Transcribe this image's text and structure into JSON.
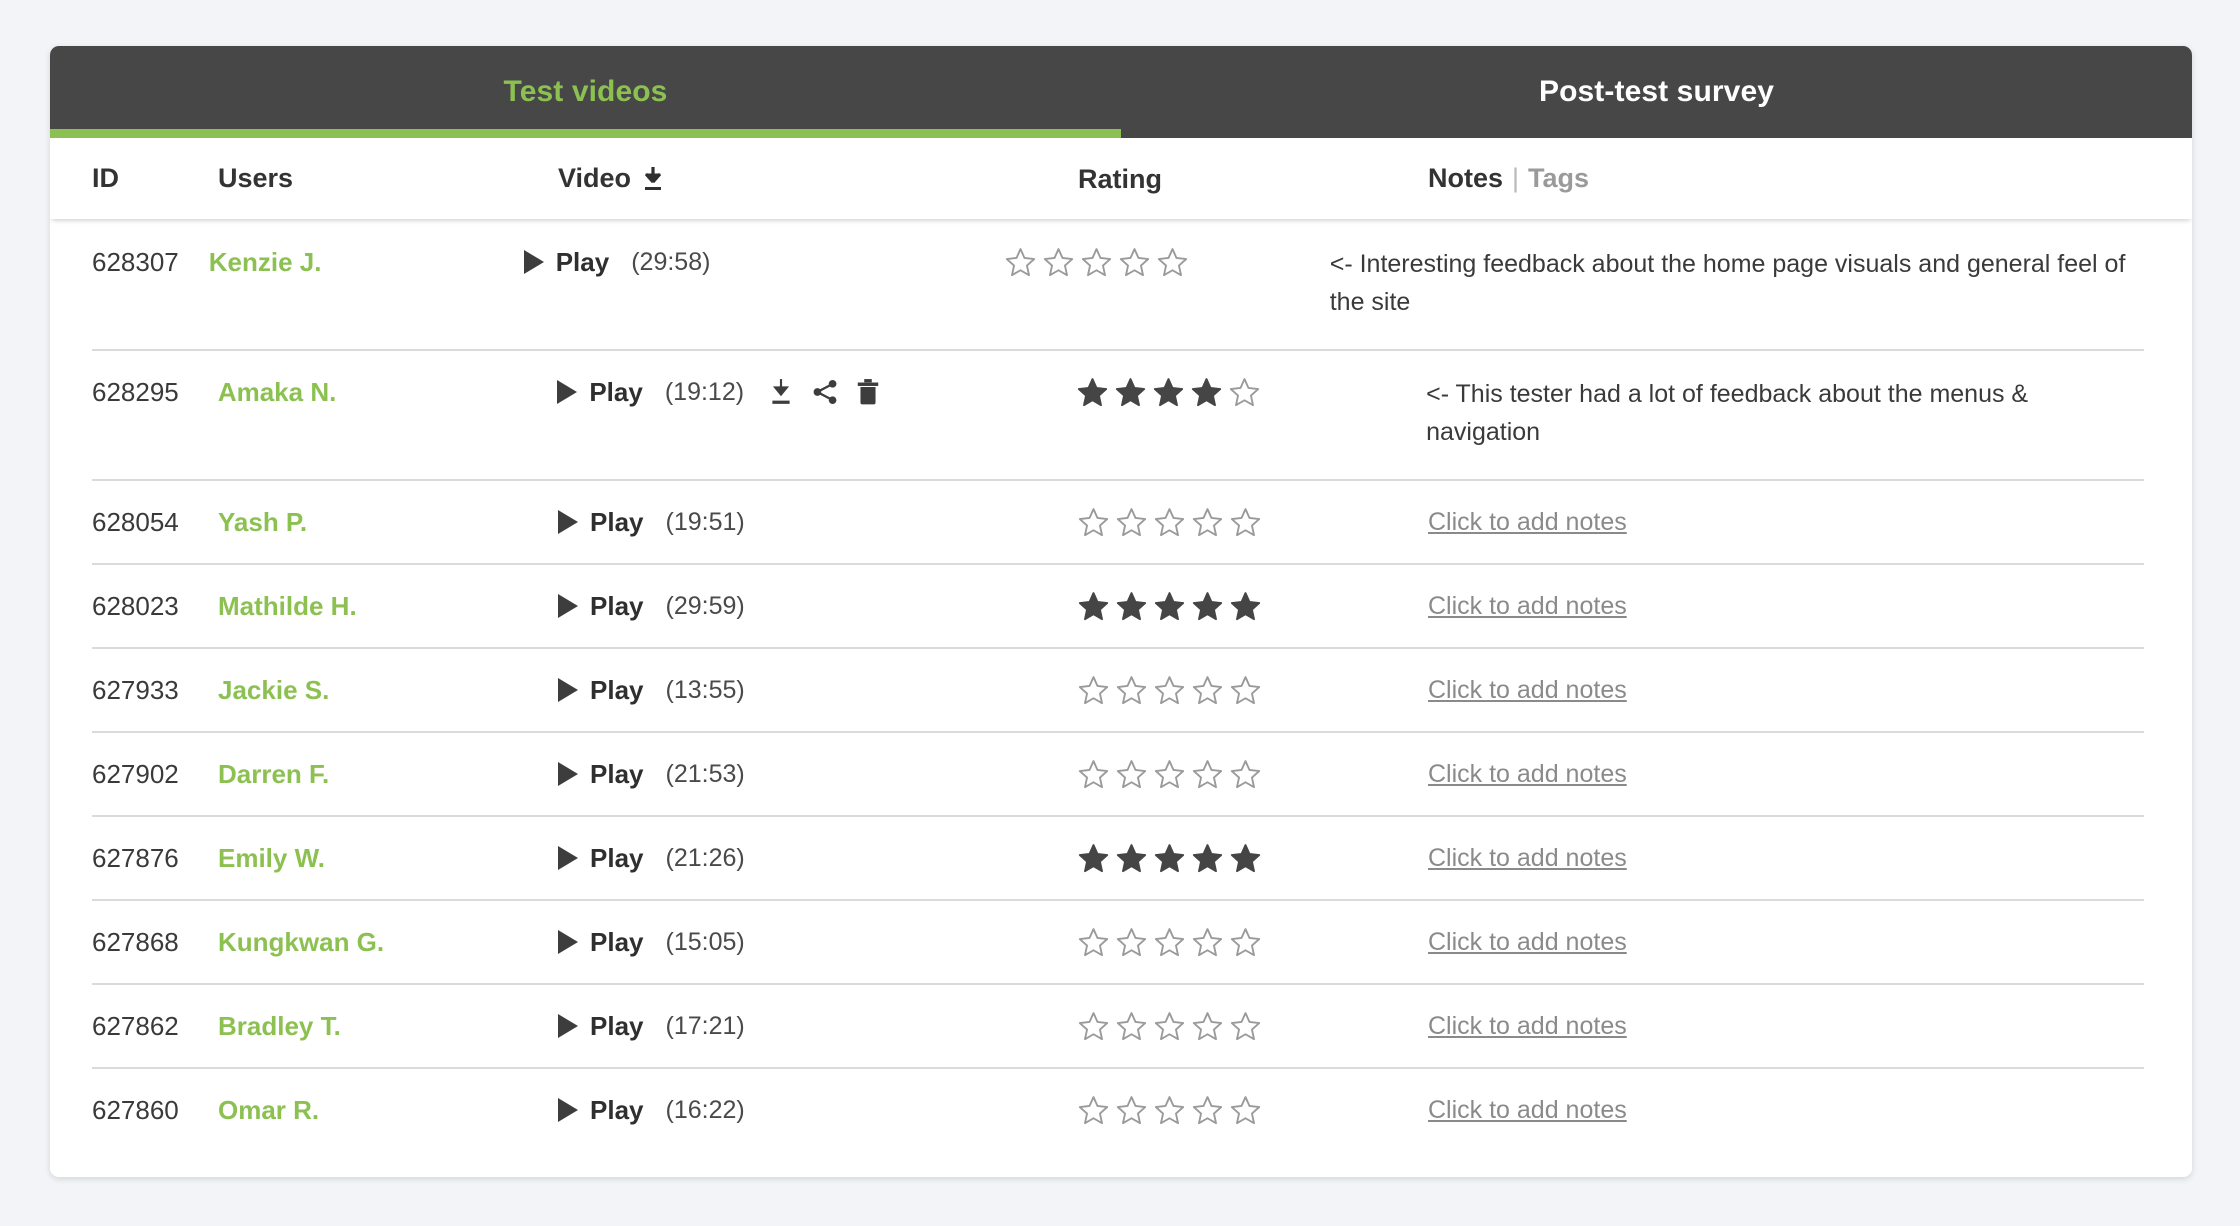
{
  "colors": {
    "accent_green": "#8cc152",
    "header_dark": "#474747",
    "page_bg": "#f2f4f7",
    "card_bg": "#ffffff",
    "star_filled": "#454545",
    "star_empty": "#9a9a9a",
    "muted_text": "#8a8a8a"
  },
  "tabs": [
    {
      "label": "Test videos",
      "active": true
    },
    {
      "label": "Post-test survey",
      "active": false
    }
  ],
  "columns": {
    "id": "ID",
    "users": "Users",
    "video": "Video",
    "video_sort_icon": "download-icon",
    "rating": "Rating",
    "notes": "Notes",
    "notes_separator": "|",
    "tags": "Tags"
  },
  "labels": {
    "play": "Play",
    "add_notes": "Click to add notes",
    "download_icon": "download-icon",
    "share_icon": "share-icon",
    "delete_icon": "trash-icon"
  },
  "rows": [
    {
      "id": "628307",
      "user": "Kenzie J.",
      "play": "Play",
      "duration": "(29:58)",
      "actions": [],
      "rating": 0,
      "note": "<- Interesting feedback about the home page visuals and general feel of the site",
      "has_note": true
    },
    {
      "id": "628295",
      "user": "Amaka N.",
      "play": "Play",
      "duration": "(19:12)",
      "actions": [
        "download-icon",
        "share-icon",
        "trash-icon"
      ],
      "rating": 4,
      "note": "<- This tester had a lot of feedback about the menus & navigation",
      "has_note": true
    },
    {
      "id": "628054",
      "user": "Yash P.",
      "play": "Play",
      "duration": "(19:51)",
      "actions": [],
      "rating": 0,
      "note": "Click to add notes",
      "has_note": false
    },
    {
      "id": "628023",
      "user": "Mathilde H.",
      "play": "Play",
      "duration": "(29:59)",
      "actions": [],
      "rating": 5,
      "note": "Click to add notes",
      "has_note": false
    },
    {
      "id": "627933",
      "user": "Jackie S.",
      "play": "Play",
      "duration": "(13:55)",
      "actions": [],
      "rating": 0,
      "note": "Click to add notes",
      "has_note": false
    },
    {
      "id": "627902",
      "user": "Darren F.",
      "play": "Play",
      "duration": "(21:53)",
      "actions": [],
      "rating": 0,
      "note": "Click to add notes",
      "has_note": false
    },
    {
      "id": "627876",
      "user": "Emily W.",
      "play": "Play",
      "duration": "(21:26)",
      "actions": [],
      "rating": 5,
      "note": "Click to add notes",
      "has_note": false
    },
    {
      "id": "627868",
      "user": "Kungkwan G.",
      "play": "Play",
      "duration": "(15:05)",
      "actions": [],
      "rating": 0,
      "note": "Click to add notes",
      "has_note": false
    },
    {
      "id": "627862",
      "user": "Bradley T.",
      "play": "Play",
      "duration": "(17:21)",
      "actions": [],
      "rating": 0,
      "note": "Click to add notes",
      "has_note": false
    },
    {
      "id": "627860",
      "user": "Omar R.",
      "play": "Play",
      "duration": "(16:22)",
      "actions": [],
      "rating": 0,
      "note": "Click to add notes",
      "has_note": false
    }
  ]
}
